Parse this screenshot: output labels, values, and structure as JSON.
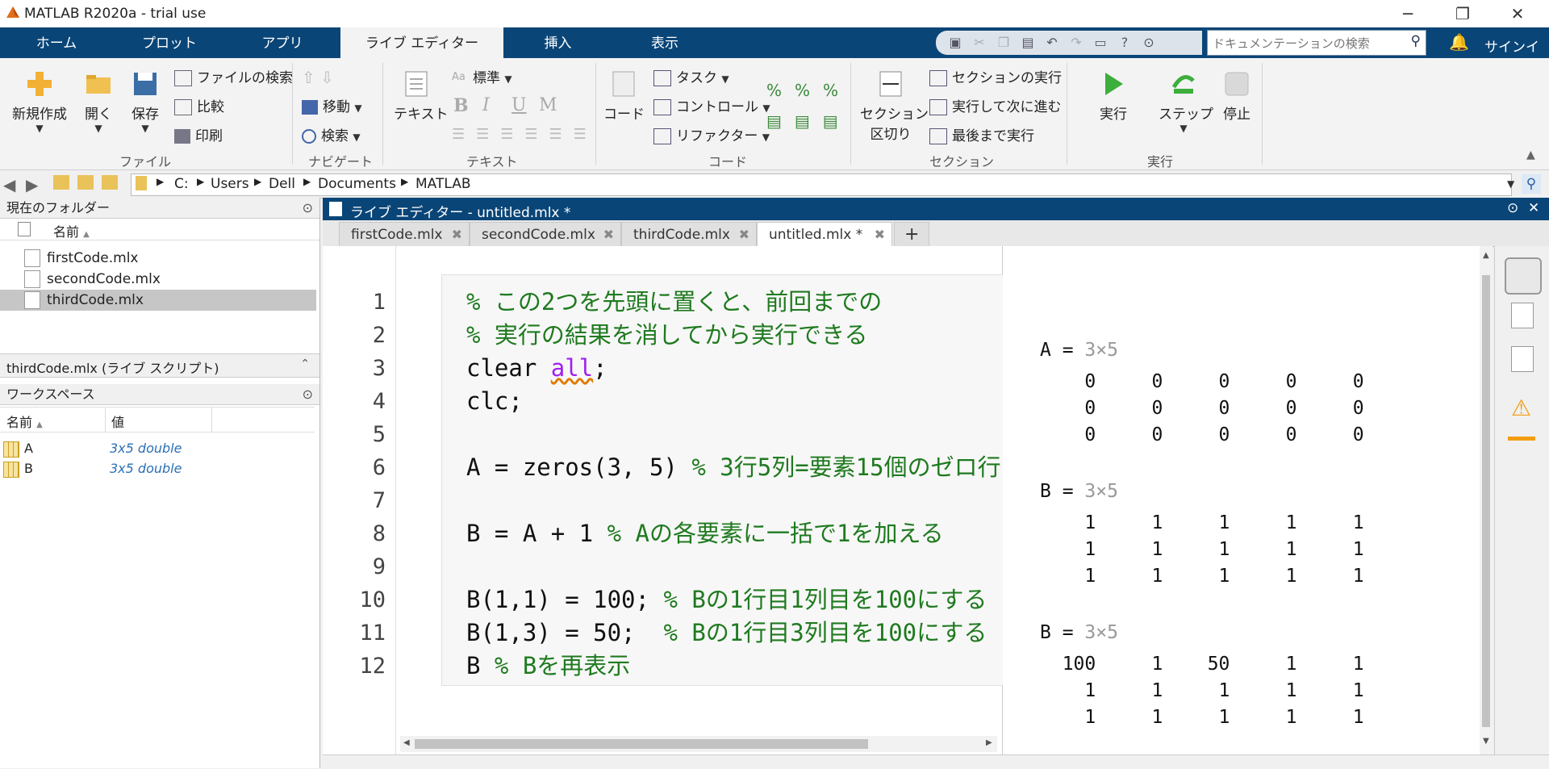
{
  "window": {
    "title": "MATLAB R2020a - trial use"
  },
  "tabs": [
    "ホーム",
    "プロット",
    "アプリ",
    "ライブ エディター",
    "挿入",
    "表示"
  ],
  "search": {
    "placeholder": "ドキュメンテーションの検索"
  },
  "signin": "サインイン",
  "ribbon": {
    "file": {
      "new": "新規作成",
      "open": "開く",
      "save": "保存",
      "find_files": "ファイルの検索",
      "compare": "比較",
      "print": "印刷",
      "group": "ファイル"
    },
    "navigate": {
      "goto": "移動",
      "find": "検索",
      "group": "ナビゲート"
    },
    "text": {
      "text": "テキスト",
      "style": "標準",
      "bold": "B",
      "italic": "I",
      "underline": "U",
      "mono": "M",
      "group": "テキスト"
    },
    "code": {
      "code": "コード",
      "task": "タスク",
      "control": "コントロール",
      "refactor": "リファクター",
      "group": "コード"
    },
    "section": {
      "break": "セクション",
      "break2": "区切り",
      "run_section": "セクションの実行",
      "run_advance": "実行して次に進む",
      "run_to_end": "最後まで実行",
      "group": "セクション"
    },
    "run": {
      "run": "実行",
      "step": "ステップ",
      "stop": "停止",
      "group": "実行"
    }
  },
  "address": {
    "drive": "C:",
    "parts": [
      "Users",
      "Dell",
      "Documents",
      "MATLAB"
    ]
  },
  "current_folder": {
    "title": "現在のフォルダー",
    "col_name": "名前",
    "files": [
      "firstCode.mlx",
      "secondCode.mlx",
      "thirdCode.mlx"
    ],
    "selected": "thirdCode.mlx",
    "details": "thirdCode.mlx (ライブ スクリプト)"
  },
  "workspace": {
    "title": "ワークスペース",
    "col_name": "名前",
    "col_value": "値",
    "vars": [
      {
        "name": "A",
        "value": "3x5 double"
      },
      {
        "name": "B",
        "value": "3x5 double"
      }
    ]
  },
  "editor": {
    "title": "ライブ エディター - untitled.mlx *",
    "tabs": [
      "firstCode.mlx",
      "secondCode.mlx",
      "thirdCode.mlx",
      "untitled.mlx *"
    ],
    "add_tab": "+",
    "line_numbers": [
      "1",
      "2",
      "3",
      "4",
      "5",
      "6",
      "7",
      "8",
      "9",
      "10",
      "11",
      "12"
    ],
    "code": {
      "l1": "% この2つを先頭に置くと、前回までの",
      "l2": "% 実行の結果を消してから実行できる",
      "l3a": "clear ",
      "l3b": "all",
      "l3c": ";",
      "l4": "clc;",
      "l6a": "A = zeros(3, 5) ",
      "l6b": "% 3行5列=要素15個のゼロ行",
      "l8a": "B = A + 1 ",
      "l8b": "% Aの各要素に一括で1を加える",
      "l10a": "B(1,1) = 100; ",
      "l10b": "% Bの1行目1列目を100にする",
      "l11a": "B(1,3) = 50;  ",
      "l11b": "% Bの1行目3列目を100にする",
      "l12a": "B ",
      "l12b": "% Bを再表示"
    }
  },
  "output": {
    "blocks": [
      {
        "var": "A = ",
        "size": "3×5",
        "rows": [
          "    0     0     0     0     0",
          "    0     0     0     0     0",
          "    0     0     0     0     0"
        ]
      },
      {
        "var": "B = ",
        "size": "3×5",
        "rows": [
          "    1     1     1     1     1",
          "    1     1     1     1     1",
          "    1     1     1     1     1"
        ]
      },
      {
        "var": "B = ",
        "size": "3×5",
        "rows": [
          "  100     1    50     1     1",
          "    1     1     1     1     1",
          "    1     1     1     1     1"
        ]
      }
    ]
  }
}
